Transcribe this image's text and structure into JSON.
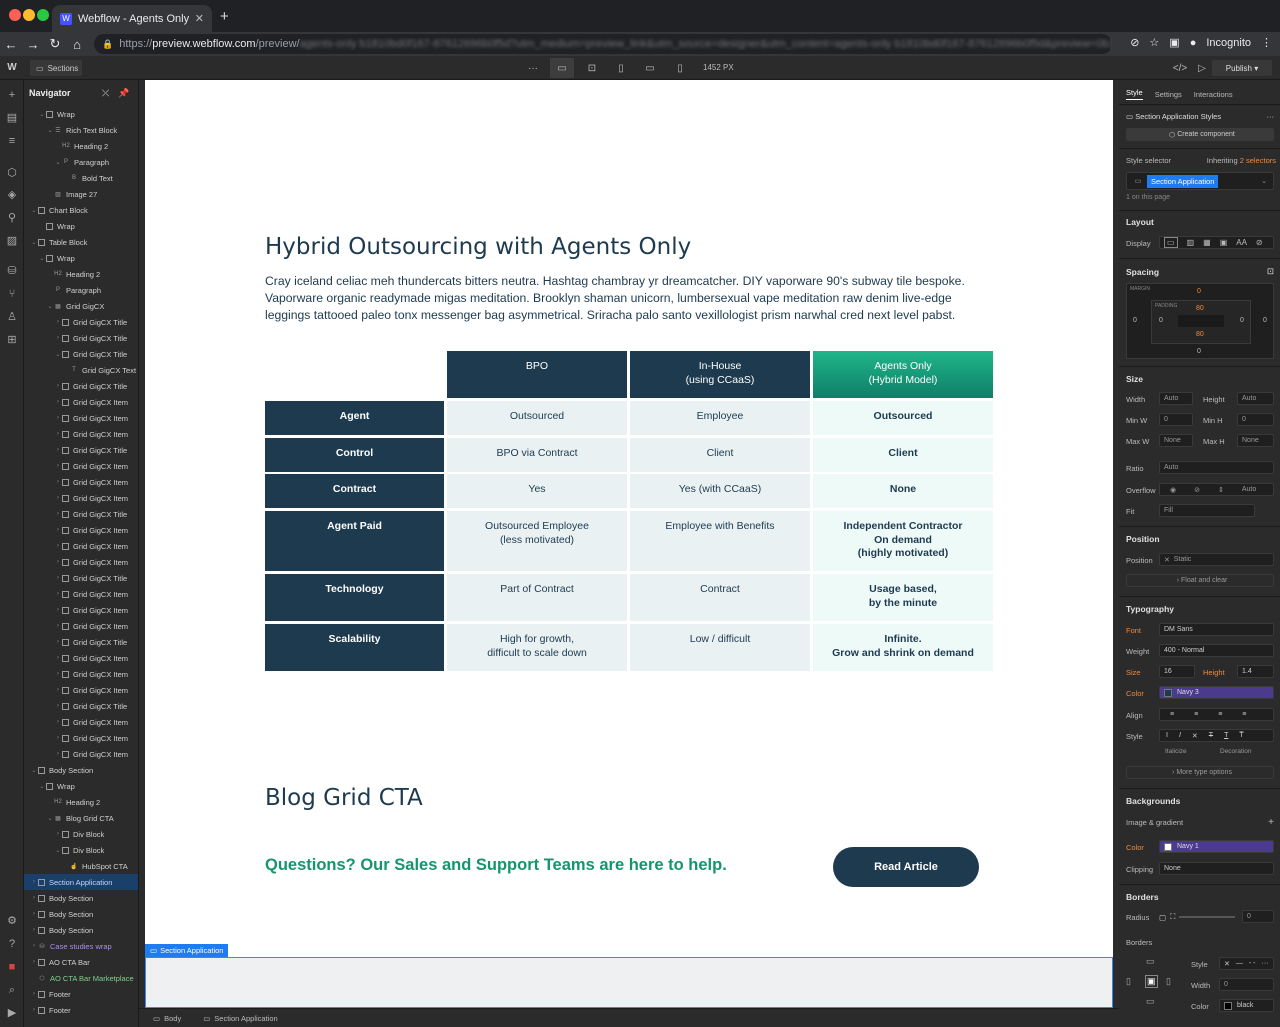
{
  "browser": {
    "tab_title": "Webflow - Agents Only Websit",
    "url_prefix": "https://",
    "url_host": "preview.webflow.com",
    "url_path": "/preview/",
    "url_rest": "agents-only b1810bd0f167-87612696b0f5d?utm_medium=preview_link&utm_source=designer&utm_content=agents-only b1810bd0f167-87612696b0f5d&preview=0b1",
    "incognito": "Incognito"
  },
  "toolbar": {
    "pages": "Sections",
    "width": "1452 PX",
    "publish": "Publish"
  },
  "navigator": {
    "title": "Navigator",
    "items": [
      {
        "label": "Wrap",
        "indent": 2,
        "kind": "box",
        "open": true
      },
      {
        "label": "Rich Text Block",
        "indent": 3,
        "kind": "rt",
        "open": true
      },
      {
        "label": "Heading 2",
        "indent": 4,
        "kind": "H2"
      },
      {
        "label": "Paragraph",
        "indent": 4,
        "kind": "P",
        "open": true
      },
      {
        "label": "Bold Text",
        "indent": 5,
        "kind": "B"
      },
      {
        "label": "Image 27",
        "indent": 3,
        "kind": "img"
      },
      {
        "label": "Chart Block",
        "indent": 1,
        "kind": "box",
        "open": true
      },
      {
        "label": "Wrap",
        "indent": 2,
        "kind": "box"
      },
      {
        "label": "Table Block",
        "indent": 1,
        "kind": "box",
        "open": true
      },
      {
        "label": "Wrap",
        "indent": 2,
        "kind": "box",
        "open": true
      },
      {
        "label": "Heading 2",
        "indent": 3,
        "kind": "H2"
      },
      {
        "label": "Paragraph",
        "indent": 3,
        "kind": "P"
      },
      {
        "label": "Grid GigCX",
        "indent": 3,
        "kind": "grid",
        "open": true
      },
      {
        "label": "Grid GigCX Title",
        "indent": 4,
        "kind": "box",
        "closed": true
      },
      {
        "label": "Grid GigCX Title",
        "indent": 4,
        "kind": "box",
        "closed": true
      },
      {
        "label": "Grid GigCX Title",
        "indent": 4,
        "kind": "box",
        "open": true
      },
      {
        "label": "Grid GigCX Text",
        "indent": 5,
        "kind": "T"
      },
      {
        "label": "Grid GigCX Title",
        "indent": 4,
        "kind": "box",
        "closed": true
      },
      {
        "label": "Grid GigCX Item",
        "indent": 4,
        "kind": "box",
        "closed": true
      },
      {
        "label": "Grid GigCX Item",
        "indent": 4,
        "kind": "box",
        "closed": true
      },
      {
        "label": "Grid GigCX Item",
        "indent": 4,
        "kind": "box",
        "closed": true
      },
      {
        "label": "Grid GigCX Title",
        "indent": 4,
        "kind": "box",
        "closed": true
      },
      {
        "label": "Grid GigCX Item",
        "indent": 4,
        "kind": "box",
        "closed": true
      },
      {
        "label": "Grid GigCX Item",
        "indent": 4,
        "kind": "box",
        "closed": true
      },
      {
        "label": "Grid GigCX Item",
        "indent": 4,
        "kind": "box",
        "closed": true
      },
      {
        "label": "Grid GigCX Title",
        "indent": 4,
        "kind": "box",
        "closed": true
      },
      {
        "label": "Grid GigCX Item",
        "indent": 4,
        "kind": "box",
        "closed": true
      },
      {
        "label": "Grid GigCX Item",
        "indent": 4,
        "kind": "box",
        "closed": true
      },
      {
        "label": "Grid GigCX Item",
        "indent": 4,
        "kind": "box",
        "closed": true
      },
      {
        "label": "Grid GigCX Title",
        "indent": 4,
        "kind": "box",
        "closed": true
      },
      {
        "label": "Grid GigCX Item",
        "indent": 4,
        "kind": "box",
        "closed": true
      },
      {
        "label": "Grid GigCX Item",
        "indent": 4,
        "kind": "box",
        "closed": true
      },
      {
        "label": "Grid GigCX Item",
        "indent": 4,
        "kind": "box",
        "closed": true
      },
      {
        "label": "Grid GigCX Title",
        "indent": 4,
        "kind": "box",
        "closed": true
      },
      {
        "label": "Grid GigCX Item",
        "indent": 4,
        "kind": "box",
        "closed": true
      },
      {
        "label": "Grid GigCX Item",
        "indent": 4,
        "kind": "box",
        "closed": true
      },
      {
        "label": "Grid GigCX Item",
        "indent": 4,
        "kind": "box",
        "closed": true
      },
      {
        "label": "Grid GigCX Title",
        "indent": 4,
        "kind": "box",
        "closed": true
      },
      {
        "label": "Grid GigCX Item",
        "indent": 4,
        "kind": "box",
        "closed": true
      },
      {
        "label": "Grid GigCX Item",
        "indent": 4,
        "kind": "box",
        "closed": true
      },
      {
        "label": "Grid GigCX Item",
        "indent": 4,
        "kind": "box",
        "closed": true
      },
      {
        "label": "Body Section",
        "indent": 1,
        "kind": "box",
        "open": true
      },
      {
        "label": "Wrap",
        "indent": 2,
        "kind": "box",
        "open": true
      },
      {
        "label": "Heading 2",
        "indent": 3,
        "kind": "H2"
      },
      {
        "label": "Blog Grid CTA",
        "indent": 3,
        "kind": "grid",
        "open": true
      },
      {
        "label": "Div Block",
        "indent": 4,
        "kind": "box",
        "closed": true
      },
      {
        "label": "Div Block",
        "indent": 4,
        "kind": "box",
        "open": true
      },
      {
        "label": "HubSpot CTA",
        "indent": 5,
        "kind": "hs"
      },
      {
        "label": "Section Application",
        "indent": 1,
        "kind": "box",
        "closed": true,
        "state": "sel"
      },
      {
        "label": "Body Section",
        "indent": 1,
        "kind": "box",
        "closed": true
      },
      {
        "label": "Body Section",
        "indent": 1,
        "kind": "box",
        "closed": true
      },
      {
        "label": "Body Section",
        "indent": 1,
        "kind": "box",
        "closed": true
      },
      {
        "label": "Case studies wrap",
        "indent": 1,
        "kind": "sym",
        "closed": true,
        "state": "sym"
      },
      {
        "label": "AO CTA Bar",
        "indent": 1,
        "kind": "box",
        "closed": true
      },
      {
        "label": "AO CTA Bar Marketplace",
        "indent": 1,
        "kind": "cmp",
        "state": "cmp"
      },
      {
        "label": "Footer",
        "indent": 1,
        "kind": "box",
        "closed": true
      },
      {
        "label": "Footer",
        "indent": 1,
        "kind": "box",
        "closed": true
      }
    ]
  },
  "page": {
    "heading1": "Hybrid Outsourcing with Agents Only",
    "paragraph": "Cray iceland celiac meh thundercats bitters neutra. Hashtag chambray yr dreamcatcher. DIY vaporware 90's subway tile bespoke. Vaporware organic readymade migas meditation. Brooklyn shaman unicorn, lumbersexual vape meditation raw denim live-edge leggings tattooed paleo tonx messenger bag asymmetrical. Sriracha palo santo vexillologist prism narwhal cred next level pabst.",
    "table": {
      "headers": [
        "BPO",
        "In-House\n(using CCaaS)",
        "Agents Only\n(Hybrid Model)"
      ],
      "rows": [
        {
          "label": "Agent",
          "cells": [
            "Outsourced",
            "Employee",
            "Outsourced"
          ]
        },
        {
          "label": "Control",
          "cells": [
            "BPO via Contract",
            "Client",
            "Client"
          ]
        },
        {
          "label": "Contract",
          "cells": [
            "Yes",
            "Yes (with CCaaS)",
            "None"
          ]
        },
        {
          "label": "Agent Paid",
          "cells": [
            "Outsourced Employee\n(less motivated)",
            "Employee with Benefits",
            "Independent Contractor\nOn demand\n(highly motivated)"
          ]
        },
        {
          "label": "Technology",
          "cells": [
            "Part of Contract",
            "Contract",
            "Usage based,\nby the minute"
          ]
        },
        {
          "label": "Scalability",
          "cells": [
            "High for growth,\ndifficult to scale down",
            "Low / difficult",
            "Infinite.\nGrow and shrink on demand"
          ]
        }
      ]
    },
    "heading2": "Blog Grid CTA",
    "cta_text": "Questions? Our Sales and Support Teams are here to help.",
    "cta_button": "Read Article",
    "selected_tag": "Section Application"
  },
  "breadcrumb": {
    "body": "Body",
    "section": "Section Application"
  },
  "style_panel": {
    "tabs": [
      "Style",
      "Settings",
      "Interactions"
    ],
    "class_title": "Section Application Styles",
    "create_component": "Create component",
    "selector_label": "Style selector",
    "inheriting": "Inheriting",
    "inheriting_count": "2 selectors",
    "selector_value": "Section Application",
    "on_page": "1 on this page",
    "layout": "Layout",
    "display": "Display",
    "spacing": "Spacing",
    "margin": "MARGIN",
    "padding": "PADDING",
    "margin_vals": {
      "top": "0",
      "right": "0",
      "bottom": "0",
      "left": "0"
    },
    "padding_vals": {
      "top": "80",
      "right": "0",
      "bottom": "80",
      "left": "0"
    },
    "size": "Size",
    "width": "Width",
    "height": "Height",
    "width_val": "Auto",
    "height_val": "Auto",
    "minw": "Min W",
    "minh": "Min H",
    "minw_val": "0",
    "minh_val": "0",
    "unit": "PX",
    "maxw": "Max W",
    "maxh": "Max H",
    "maxw_val": "None",
    "maxh_val": "None",
    "ratio": "Ratio",
    "ratio_val": "Auto",
    "overflow": "Overflow",
    "overflow_auto": "Auto",
    "fit": "Fit",
    "fit_val": "Fill",
    "position": "Position",
    "position_lbl": "Position",
    "position_val": "Static",
    "float": "Float and clear",
    "typography": "Typography",
    "font": "Font",
    "font_val": "DM Sans",
    "weight": "Weight",
    "weight_val": "400 - Normal",
    "size_lbl": "Size",
    "size_val": "16",
    "height_lbl": "Height",
    "height_val2": "1.4",
    "color": "Color",
    "color_val": "Navy 3",
    "align": "Align",
    "style": "Style",
    "italicize": "Italicize",
    "decoration": "Decoration",
    "more_type": "More type options",
    "backgrounds": "Backgrounds",
    "image_gradient": "Image & gradient",
    "bg_color": "Color",
    "bg_color_val": "Navy 1",
    "clipping": "Clipping",
    "clipping_val": "None",
    "borders": "Borders",
    "radius": "Radius",
    "radius_val": "0",
    "borders_lbl": "Borders",
    "b_style": "Style",
    "b_width": "Width",
    "b_width_val": "0",
    "b_color": "Color",
    "b_color_val": "black"
  },
  "colors": {
    "navy": "#1d3a4f",
    "green": "#15956d",
    "accent": "#1e7cf0"
  }
}
